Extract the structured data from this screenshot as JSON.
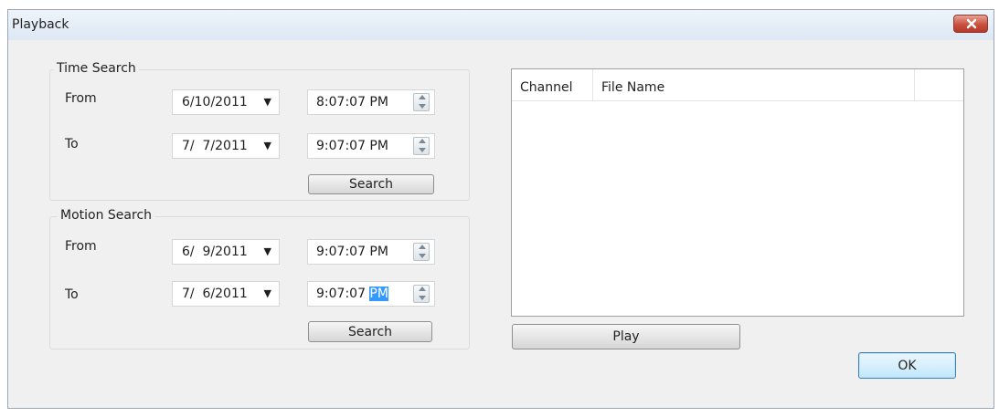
{
  "window": {
    "title": "Playback"
  },
  "icons": {
    "close": "close-icon",
    "dropdown": "chevron-down-icon",
    "spin_up": "spin-up-icon",
    "spin_down": "spin-down-icon"
  },
  "time_search": {
    "legend": "Time Search",
    "from_label": "From",
    "from_date": "6/10/2011",
    "from_time": "8:07:07 PM",
    "to_label": "To",
    "to_date": "7/  7/2011",
    "to_time": "9:07:07 PM",
    "search_label": "Search"
  },
  "motion_search": {
    "legend": "Motion Search",
    "from_label": "From",
    "from_date": "6/  9/2011",
    "from_time": "9:07:07 PM",
    "to_label": "To",
    "to_date": "7/  6/2011",
    "to_time_main": "9:07:07 ",
    "to_time_selected": "PM",
    "search_label": "Search"
  },
  "results": {
    "columns": [
      "Channel",
      "File Name",
      ""
    ],
    "rows": []
  },
  "play_label": "Play",
  "ok_label": "OK",
  "colors": {
    "selection": "#3399ff",
    "close_button": "#c9503f",
    "ok_border": "#3c7fb1"
  }
}
